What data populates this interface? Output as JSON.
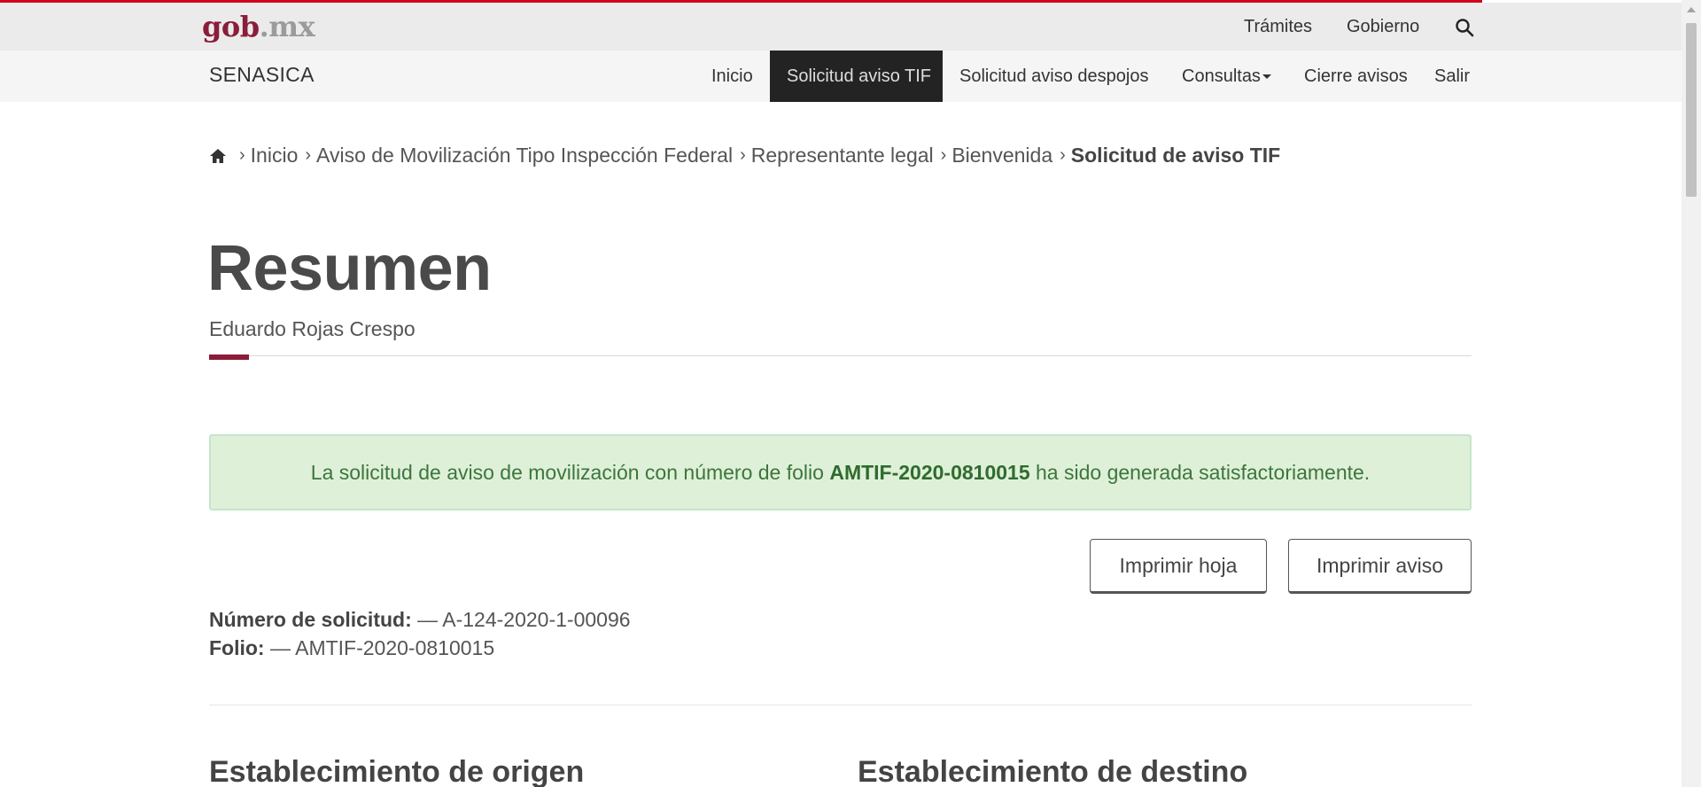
{
  "gob_bar": {
    "logo_part1": "gob",
    "logo_part2": ".mx",
    "links": [
      "Trámites",
      "Gobierno"
    ],
    "search_icon": "search-icon"
  },
  "app_nav": {
    "brand": "SENASICA",
    "items": [
      {
        "label": "Inicio",
        "active": false
      },
      {
        "label": "Solicitud aviso TIF",
        "active": true
      },
      {
        "label": "Solicitud aviso despojos",
        "active": false
      },
      {
        "label": "Consultas",
        "active": false,
        "dropdown": true
      },
      {
        "label": "Cierre avisos",
        "active": false
      },
      {
        "label": "Salir",
        "active": false
      }
    ]
  },
  "breadcrumb": {
    "home_icon": "home-icon",
    "items": [
      "Inicio",
      "Aviso de Movilización Tipo Inspección Federal",
      "Representante legal",
      "Bienvenida"
    ],
    "current": "Solicitud de aviso TIF"
  },
  "header": {
    "title": "Resumen",
    "subtitle": "Eduardo Rojas Crespo"
  },
  "alert": {
    "prefix": "La solicitud de aviso de movilización con número de folio",
    "folio": "AMTIF-2020-0810015",
    "suffix": "ha sido generada satisfactoriamente."
  },
  "actions": {
    "print_sheet": "Imprimir hoja",
    "print_notice": "Imprimir aviso"
  },
  "summary": {
    "request_label": "Número de solicitud:",
    "request_value": "— A-124-2020-1-00096",
    "folio_label": "Folio:",
    "folio_value": "— AMTIF-2020-0810015"
  },
  "sections": {
    "origin": "Establecimiento de origen",
    "destination": "Establecimiento de destino"
  },
  "colors": {
    "accent": "#8a1d39",
    "top_line": "#d0021b",
    "alert_bg": "#dff0d8",
    "nav_active_bg": "#232323"
  }
}
